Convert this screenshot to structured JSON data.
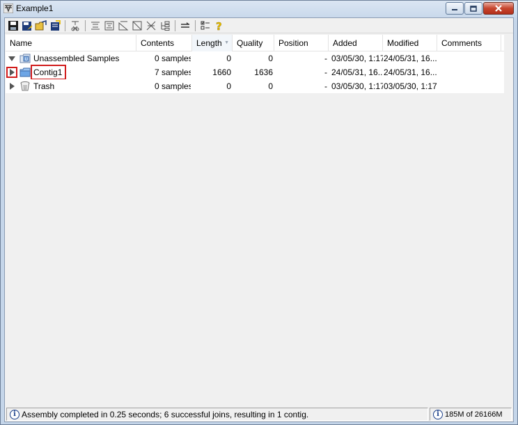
{
  "window": {
    "title": "Example1"
  },
  "toolbar": {
    "buttons": [
      {
        "icon": "save-icon"
      },
      {
        "icon": "save-as-icon"
      },
      {
        "icon": "open-icon"
      },
      {
        "icon": "export-icon"
      },
      {
        "icon": "cut-icon"
      },
      {
        "icon": "assemble-icon"
      },
      {
        "icon": "align-icon"
      },
      {
        "icon": "trim-icon"
      },
      {
        "icon": "trim-all-icon"
      },
      {
        "icon": "unassemble-icon"
      },
      {
        "icon": "tree-icon"
      },
      {
        "icon": "split-icon"
      },
      {
        "icon": "checklist-icon"
      },
      {
        "icon": "help-icon"
      }
    ]
  },
  "table": {
    "columns": {
      "name": "Name",
      "contents": "Contents",
      "length": "Length",
      "quality": "Quality",
      "position": "Position",
      "added": "Added",
      "modified": "Modified",
      "comments": "Comments"
    },
    "rows": [
      {
        "name": "Unassembled Samples",
        "contents": "0 samples",
        "length": "0",
        "quality": "0",
        "position": "-",
        "added": "03/05/30, 1:17",
        "modified": "24/05/31, 16...",
        "icon": "unassembled-folder-icon"
      },
      {
        "name": "Contig1",
        "contents": "7 samples",
        "length": "1660",
        "quality": "1636",
        "position": "-",
        "added": "24/05/31, 16...",
        "modified": "24/05/31, 16...",
        "icon": "contig-folder-icon"
      },
      {
        "name": "Trash",
        "contents": "0 samples",
        "length": "0",
        "quality": "0",
        "position": "-",
        "added": "03/05/30, 1:17",
        "modified": "03/05/30, 1:17",
        "icon": "trash-icon"
      }
    ]
  },
  "status": {
    "message": "Assembly completed in 0.25 seconds; 6 successful joins, resulting in 1 contig.",
    "memory": "185M of 26166M"
  },
  "colors": {
    "highlight": "#d11a1a",
    "folder": "#4a8fd8",
    "selection": "#ffffff"
  }
}
